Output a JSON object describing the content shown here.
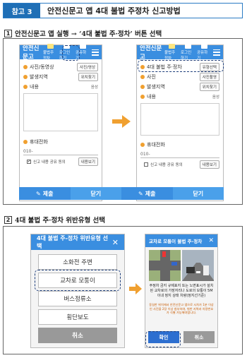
{
  "header": {
    "tag": "참고 3",
    "title": "안전신문고 앱 4대 불법 주정차 신고방법"
  },
  "step1": {
    "num": "1",
    "text": "안전신문고 앱 실행 → ‘4대 불법 주·정차’ 버튼 선택"
  },
  "step2": {
    "num": "2",
    "text": "4대 불법 주·정차 위반유형 선택"
  },
  "app": {
    "title": "안전신문고",
    "buttons": [
      "불법주정차",
      "로그인하기",
      "공유하기"
    ],
    "photo_label": "사진/동영상",
    "photo_label2": "사진",
    "photo_btn": "사진/영상",
    "photo_btn2": "사진촬영",
    "type_label": "4대 불법 주·정차",
    "type_btn": "유형선택",
    "location_label": "발생지역",
    "location_btn": "위치찾기",
    "content_label": "내용",
    "content_hint": "음성",
    "phone_label": "휴대전화",
    "phone_value": "010-",
    "agree_label": "신고 내용 공유 동의",
    "view_btn": "내용보기",
    "submit": "제출",
    "close": "닫기"
  },
  "dialog1": {
    "title": "4대 불법 주-정차 위반유형 선택",
    "options": [
      "소화전 주변",
      "교차로 모퉁이",
      "버스정류소",
      "횡단보도"
    ],
    "cancel": "취소"
  },
  "dialog2": {
    "title": "교차로 모퉁이 불법 주-정차",
    "desc": "주정차 금지 규제표지 또는 노면표시가 설치된 교차로의 가장자리나 도로의 모퉁이 5M 이내 정지 상태 차량(정지선기준)",
    "note": "동일한 위치에서 안전신문고 앱으로 시차가 1분 이상인 사진을 2장 이상 첨부하여, 위반 지역과 차량번호가 식별 가능해야합니다.",
    "confirm": "확인",
    "cancel": "취소"
  },
  "colors": {
    "blue": "#3a8ee0",
    "orange": "#f0a030",
    "navy": "#1c3d7a"
  }
}
